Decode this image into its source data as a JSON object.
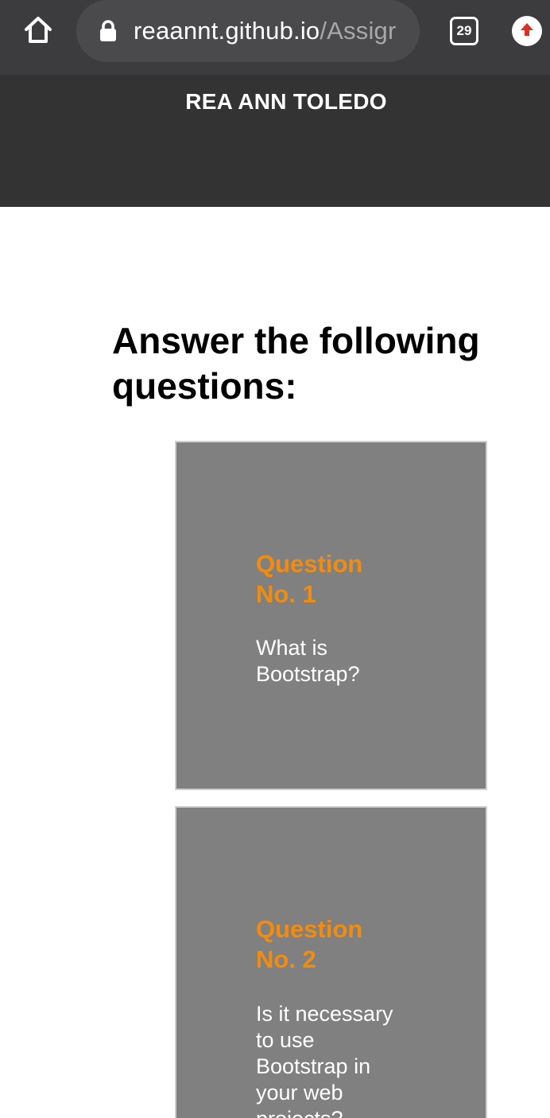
{
  "browser": {
    "url_domain": "reaannt.github.io",
    "url_path": "/Assigr",
    "tab_count": "29",
    "icons": {
      "home": "home-icon",
      "lock": "lock-icon",
      "tabs": "tab-switcher-icon",
      "update": "update-arrow-icon"
    }
  },
  "header": {
    "title": "REA ANN TOLEDO"
  },
  "main": {
    "heading": "Answer the following questions:",
    "questions": [
      {
        "title": "Question No. 1",
        "text": "What is Bootstrap?"
      },
      {
        "title": "Question No. 2",
        "text": "Is it necessary to use Bootstrap in your web projects?"
      }
    ]
  },
  "colors": {
    "chrome_bg": "#3c3c3e",
    "header_bg": "#333333",
    "card_bg": "#808080",
    "accent": "#f28c0f"
  }
}
